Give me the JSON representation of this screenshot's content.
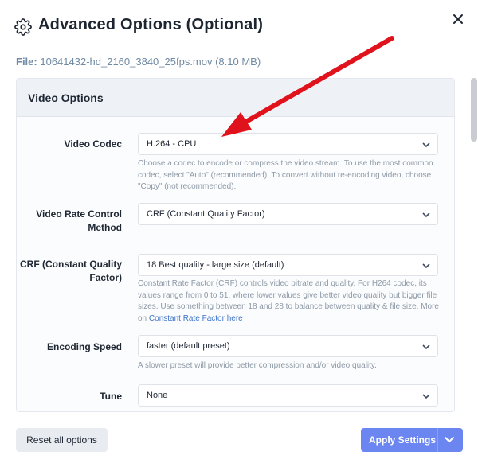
{
  "header": {
    "title": "Advanced Options (Optional)",
    "icon": "gear-icon",
    "close_icon": "close-icon"
  },
  "file": {
    "label": "File:",
    "name": "10641432-hd_2160_3840_25fps.mov (8.10 MB)"
  },
  "panel": {
    "title": "Video Options",
    "fields": [
      {
        "label": "Video Codec",
        "value": "H.264 - CPU",
        "hint": "Choose a codec to encode or compress the video stream. To use the most common codec, select \"Auto\" (recommended). To convert without re-encoding video, choose \"Copy\" (not recommended)."
      },
      {
        "label": "Video Rate Control Method",
        "value": "CRF (Constant Quality Factor)"
      },
      {
        "label": "CRF (Constant Quality Factor)",
        "value": "18 Best quality - large size (default)",
        "hint": "Constant Rate Factor (CRF) controls video bitrate and quality. For H264 codec, its values range from 0 to 51, where lower values give better video quality but bigger file sizes. Use something between 18 and 28 to balance between quality & file size. More on",
        "hint_link": "Constant Rate Factor here"
      },
      {
        "label": "Encoding Speed",
        "value": "faster (default preset)",
        "hint": "A slower preset will provide better compression and/or video quality."
      },
      {
        "label": "Tune",
        "value": "None"
      }
    ]
  },
  "footer": {
    "reset_label": "Reset all options",
    "apply_label": "Apply Settings"
  },
  "colors": {
    "accent": "#6b86f0",
    "link": "#3f74c9",
    "annotation_arrow": "#e0121b"
  }
}
